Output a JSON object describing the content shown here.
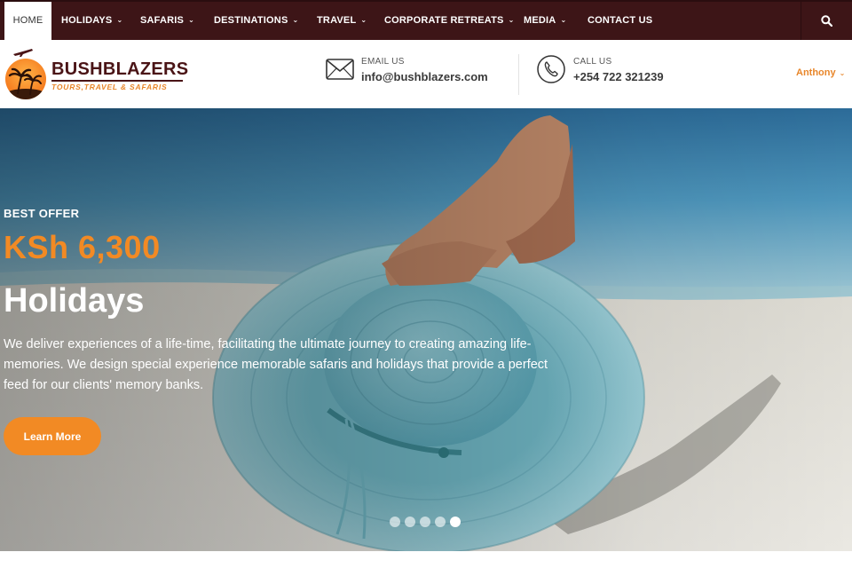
{
  "nav": {
    "items": [
      {
        "label": "HOME",
        "has_dropdown": false,
        "active": true
      },
      {
        "label": "HOLIDAYS",
        "has_dropdown": true
      },
      {
        "label": "SAFARIS",
        "has_dropdown": true
      },
      {
        "label": "DESTINATIONS",
        "has_dropdown": true
      },
      {
        "label": "TRAVEL",
        "has_dropdown": true
      },
      {
        "label": "CORPORATE RETREATS",
        "has_dropdown": true
      },
      {
        "label": "MEDIA",
        "has_dropdown": true
      },
      {
        "label": "CONTACT US",
        "has_dropdown": false
      }
    ],
    "search_icon": "search-icon"
  },
  "header": {
    "logo": {
      "title": "BUSHBLAZERS",
      "subtitle": "TOURS,TRAVEL & SAFARIS"
    },
    "email": {
      "label": "EMAIL US",
      "value": "info@bushblazers.com",
      "icon": "envelope-icon"
    },
    "call": {
      "label": "CALL US",
      "value": "+254 722 321239",
      "icon": "phone-icon"
    },
    "user": {
      "name": "Anthony"
    }
  },
  "hero": {
    "eyebrow": "BEST OFFER",
    "price": "KSh 6,300",
    "title": "Holidays",
    "description": "We deliver experiences of a life-time, facilitating the ultimate journey to creating amazing life-memories. We design special experience memorable safaris and holidays that provide a perfect feed for our clients' memory banks.",
    "cta_label": "Learn More",
    "slides_count": 5,
    "active_slide": 5
  },
  "colors": {
    "nav_bg": "#3d1517",
    "accent": "#f28a24",
    "brand_dark": "#4a1416"
  }
}
